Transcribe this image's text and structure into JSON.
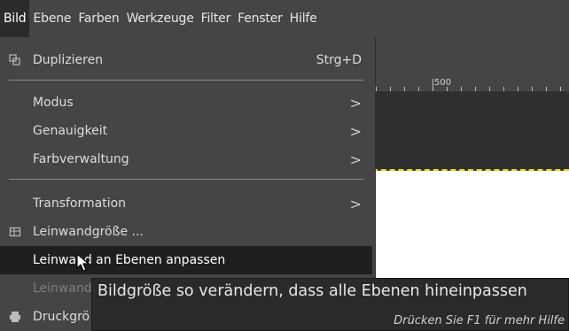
{
  "menubar": {
    "items": [
      "Bild",
      "Ebene",
      "Farben",
      "Werkzeuge",
      "Filter",
      "Fenster",
      "Hilfe"
    ],
    "active": "Bild"
  },
  "ruler": {
    "label": "500"
  },
  "menu": {
    "duplicate": {
      "label": "Duplizieren",
      "shortcut": "Strg+D",
      "icon": "duplicate-icon"
    },
    "mode": {
      "label": "Modus",
      "arrow": ">"
    },
    "precision": {
      "label": "Genauigkeit",
      "arrow": ">"
    },
    "color_management": {
      "label": "Farbverwaltung",
      "arrow": ">"
    },
    "transform": {
      "label": "Transformation",
      "arrow": ">"
    },
    "canvas_size": {
      "label": "Leinwandgröße ...",
      "icon": "canvas-size-icon"
    },
    "fit_canvas_layers": {
      "label": "Leinwand an Ebenen anpassen"
    },
    "fit_canvas_selection": {
      "label": "Leinwand"
    },
    "print_size": {
      "label": "Druckgrö",
      "icon": "print-icon"
    }
  },
  "tooltip": {
    "text": "Bildgröße so verändern, dass alle Ebenen hineinpassen",
    "hint": "Drücken Sie F1 für mehr Hilfe"
  },
  "colors": {
    "background": "#454545",
    "highlight": "#1f1f1f",
    "tooltip_bg": "#2a2a2a",
    "canvas_border": "#f0d400",
    "canvas": "#ffffff"
  }
}
